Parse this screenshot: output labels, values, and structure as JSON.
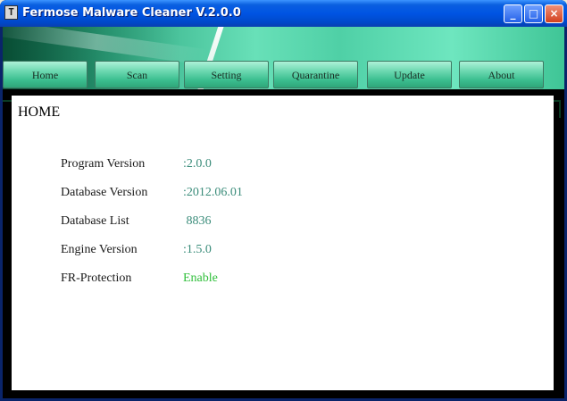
{
  "window": {
    "title": "Fermose Malware Cleaner V.2.0.0",
    "buttons": {
      "minimize": "_",
      "maximize": "□",
      "close": "×"
    },
    "app_icon": "T"
  },
  "nav": {
    "tabs": [
      {
        "label": "Home"
      },
      {
        "label": "Scan"
      },
      {
        "label": "Setting"
      },
      {
        "label": "Quarantine"
      },
      {
        "label": "Update"
      },
      {
        "label": "About"
      }
    ]
  },
  "home": {
    "title": "HOME",
    "rows": [
      {
        "label": "Program Version",
        "value": ":2.0.0"
      },
      {
        "label": "Database Version",
        "value": ":2012.06.01"
      },
      {
        "label": "Database List",
        "value": " 8836"
      },
      {
        "label": "Engine Version",
        "value": ":1.5.0"
      },
      {
        "label": "FR-Protection",
        "value": "Enable"
      }
    ]
  },
  "colors": {
    "title_bar": "#0054e3",
    "banner": "#4fd0a6",
    "value_text": "#3a8c7a",
    "enable_text": "#2fbf3a"
  }
}
